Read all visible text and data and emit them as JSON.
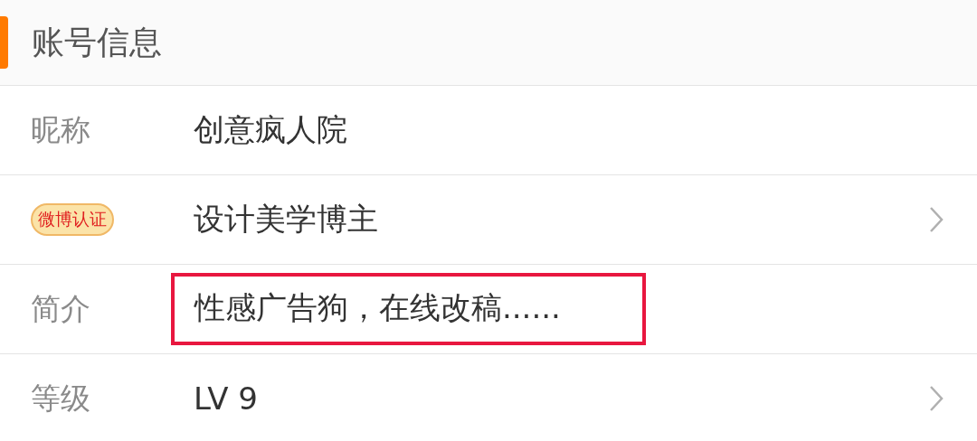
{
  "section": {
    "title": "账号信息"
  },
  "rows": [
    {
      "label": "昵称",
      "kind": "text",
      "value": "创意疯人院",
      "chevron": false,
      "highlighted": false
    },
    {
      "label": "微博认证",
      "kind": "badge",
      "value": "设计美学博主",
      "chevron": true,
      "highlighted": false
    },
    {
      "label": "简介",
      "kind": "text",
      "value": "性感广告狗，在线改稿......",
      "chevron": false,
      "highlighted": true
    },
    {
      "label": "等级",
      "kind": "text",
      "value": "LV 9",
      "chevron": true,
      "highlighted": false
    }
  ]
}
